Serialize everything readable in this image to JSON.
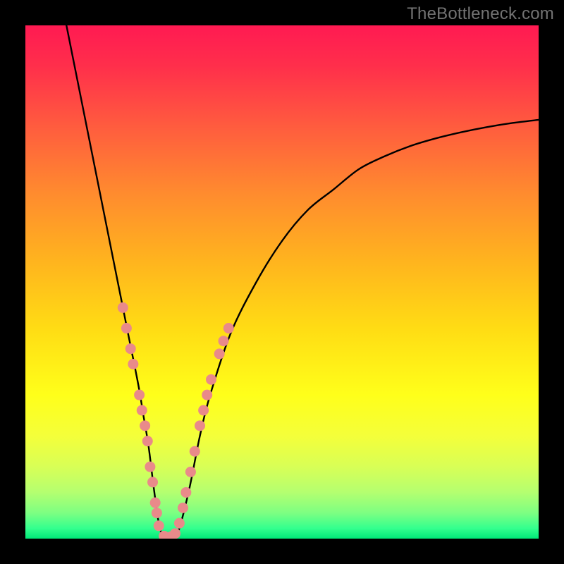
{
  "watermark": "TheBottleneck.com",
  "chart_data": {
    "type": "line",
    "title": "",
    "xlabel": "",
    "ylabel": "",
    "xlim": [
      0,
      100
    ],
    "ylim": [
      0,
      100
    ],
    "curve": {
      "name": "bottleneck-curve",
      "x": [
        8,
        10,
        12,
        14,
        16,
        18,
        20,
        22,
        23,
        24,
        25,
        26,
        27,
        28,
        29,
        30,
        32,
        34,
        36,
        40,
        45,
        50,
        55,
        60,
        65,
        70,
        75,
        80,
        85,
        90,
        95,
        100
      ],
      "y": [
        100,
        90,
        80,
        70,
        60,
        50,
        40,
        30,
        24,
        18,
        10,
        3,
        0,
        0,
        0,
        2,
        10,
        20,
        28,
        40,
        50,
        58,
        64,
        68,
        72,
        74.5,
        76.5,
        78,
        79.2,
        80.2,
        81,
        81.6
      ]
    },
    "scatter": {
      "name": "highlight-points",
      "color": "#e98a8a",
      "points": [
        {
          "x": 19.0,
          "y": 45
        },
        {
          "x": 19.7,
          "y": 41
        },
        {
          "x": 20.5,
          "y": 37
        },
        {
          "x": 21.0,
          "y": 34
        },
        {
          "x": 22.2,
          "y": 28
        },
        {
          "x": 22.7,
          "y": 25
        },
        {
          "x": 23.3,
          "y": 22
        },
        {
          "x": 23.8,
          "y": 19
        },
        {
          "x": 24.3,
          "y": 14
        },
        {
          "x": 24.8,
          "y": 11
        },
        {
          "x": 25.3,
          "y": 7
        },
        {
          "x": 25.6,
          "y": 5
        },
        {
          "x": 26.0,
          "y": 2.5
        },
        {
          "x": 27.0,
          "y": 0.5
        },
        {
          "x": 27.6,
          "y": 0.2
        },
        {
          "x": 28.4,
          "y": 0.4
        },
        {
          "x": 29.2,
          "y": 1
        },
        {
          "x": 30.0,
          "y": 3
        },
        {
          "x": 30.7,
          "y": 6
        },
        {
          "x": 31.3,
          "y": 9
        },
        {
          "x": 32.2,
          "y": 13
        },
        {
          "x": 33.0,
          "y": 17
        },
        {
          "x": 34.0,
          "y": 22
        },
        {
          "x": 34.7,
          "y": 25
        },
        {
          "x": 35.4,
          "y": 28
        },
        {
          "x": 36.2,
          "y": 31
        },
        {
          "x": 37.8,
          "y": 36
        },
        {
          "x": 38.6,
          "y": 38.5
        },
        {
          "x": 39.6,
          "y": 41
        }
      ]
    }
  }
}
